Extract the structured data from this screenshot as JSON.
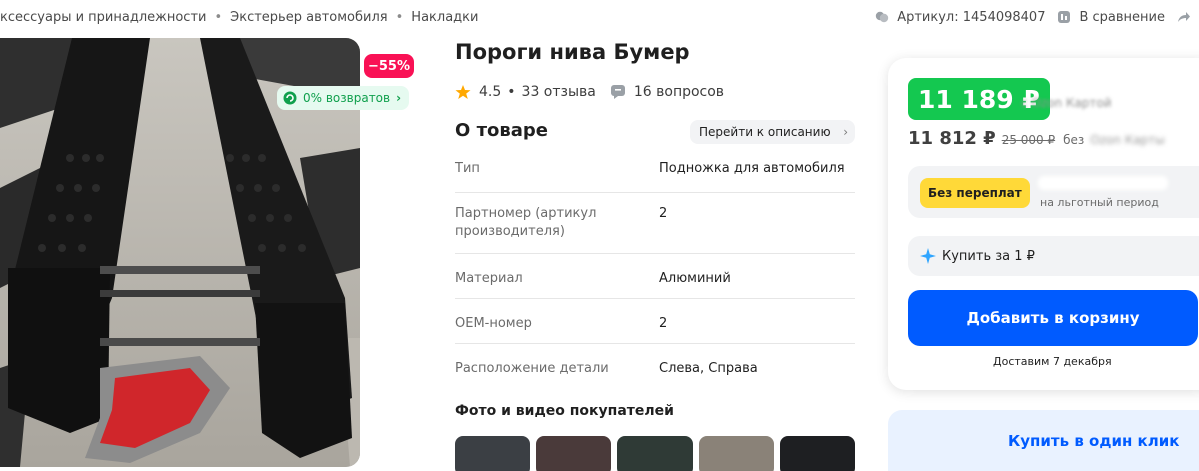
{
  "breadcrumb": {
    "items": [
      "ксессуары и принадлежности",
      "Экстерьер автомобиля",
      "Накладки"
    ],
    "separator": "•"
  },
  "top_actions": {
    "article": "Артикул: 1454098407",
    "compare": "В сравнение",
    "share_icon": "share-arrow-icon"
  },
  "photo": {
    "alt_icon": "product-photo"
  },
  "badges": {
    "discount": "−55%",
    "returns": "0% возвратов",
    "returns_chevron": "›"
  },
  "product": {
    "title": "Пороги нива Бумер",
    "rating": "4.5",
    "dot": "•",
    "reviews": "33 отзыва",
    "questions": "16 вопросов"
  },
  "about": {
    "title": "О товаре",
    "link": "Перейти к описанию",
    "link_chevron": "›"
  },
  "specs": [
    {
      "key": "Тип",
      "value": "Подножка для автомобиля"
    },
    {
      "key": "Партномер (артикул производителя)",
      "value": "2"
    },
    {
      "key": "Материал",
      "value": "Алюминий"
    },
    {
      "key": "OEM-номер",
      "value": "2"
    },
    {
      "key": "Расположение детали",
      "value": "Слева, Справа"
    }
  ],
  "ugc": {
    "title": "Фото и видео покупателей"
  },
  "price": {
    "main": "11 189 ₽",
    "main_note": "с Ozon Картой",
    "secondary": "11 812 ₽",
    "old": "25 000 ₽",
    "secondary_note": "без",
    "secondary_blur": "Ozon Карты"
  },
  "installment": {
    "tag": "Без переплат",
    "note": "на льготный период"
  },
  "buy_one": {
    "label": "Купить за 1 ₽"
  },
  "cart": {
    "add_label": "Добавить в корзину",
    "delivery": "Доставим 7 декабря"
  },
  "one_click": {
    "label": "Купить в один клик"
  },
  "colors": {
    "accent_blue": "#005bff",
    "price_green": "#14c850",
    "discount_pink": "#f91155",
    "returns_green": "#10a04d",
    "tag_yellow": "#ffd938"
  }
}
